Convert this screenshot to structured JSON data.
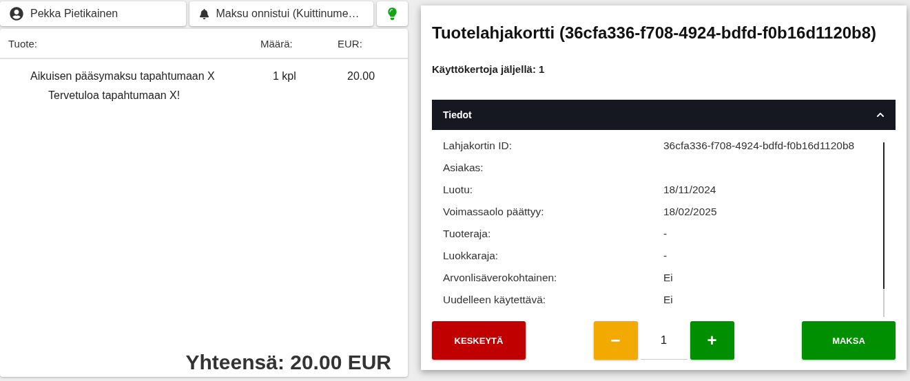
{
  "top_bar": {
    "user": "Pekka Pietikainen",
    "notification": "Maksu onnistui (Kuittinume…"
  },
  "cart": {
    "columns": [
      "Tuote:",
      "Määrä:",
      "EUR:"
    ],
    "rows": [
      {
        "product": "Aikuisen pääsymaksu tapahtumaan X",
        "quantity": "1 kpl",
        "price": "20.00",
        "note": "Tervetuloa tapahtumaan X!"
      }
    ],
    "total": "Yhteensä: 20.00 EUR"
  },
  "dialog": {
    "title": "Tuotelahjakortti (36cfa336-f708-4924-bdfd-f0b16d1120b8)",
    "uses_left": "Käyttökertoja jäljellä: 1",
    "details": {
      "title": "Tiedot",
      "expanded": true,
      "rows": [
        {
          "label": "Lahjakortin ID:",
          "value": "36cfa336-f708-4924-bdfd-f0b16d1120b8"
        },
        {
          "label": "Asiakas:"
        },
        {
          "label": "Luotu:",
          "value": "18/11/2024"
        },
        {
          "label": "Voimassaolo päättyy:",
          "value": "18/02/2025"
        },
        {
          "label": "Tuoteraja:",
          "value": "-"
        },
        {
          "label": "Luokkaraja:",
          "value": "-"
        },
        {
          "label": "Arvonlisäverokohtainen:",
          "value": "Ei"
        },
        {
          "label": "Uudelleen käytettävä:",
          "value": "Ei"
        }
      ]
    },
    "cancel": "KESKEYTÄ",
    "decrement": "−",
    "quantity": "1",
    "increment": "+",
    "pay": "MAKSA"
  }
}
